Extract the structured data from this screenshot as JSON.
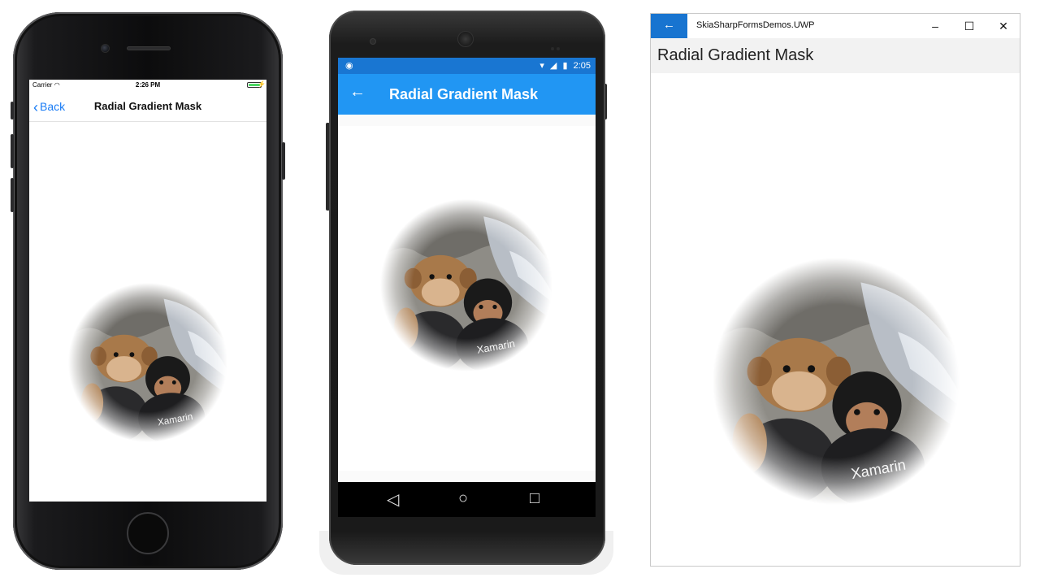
{
  "ios": {
    "status": {
      "carrier": "Carrier",
      "time": "2:26 PM"
    },
    "nav": {
      "back_label": "Back",
      "title": "Radial Gradient Mask"
    }
  },
  "android": {
    "status": {
      "time": "2:05"
    },
    "toolbar": {
      "back_icon": "←",
      "title": "Radial Gradient Mask"
    },
    "navbar": {
      "back": "◁",
      "home": "○",
      "recents": "□"
    }
  },
  "uwp": {
    "window_title": "SkiaSharpFormsDemos.UWP",
    "back_icon": "←",
    "controls": {
      "minimize": "–",
      "maximize": "☐",
      "close": "✕"
    },
    "page_title": "Radial Gradient Mask",
    "accent": "#1874d0"
  },
  "photo": {
    "shirt_text": "Xamarin"
  }
}
